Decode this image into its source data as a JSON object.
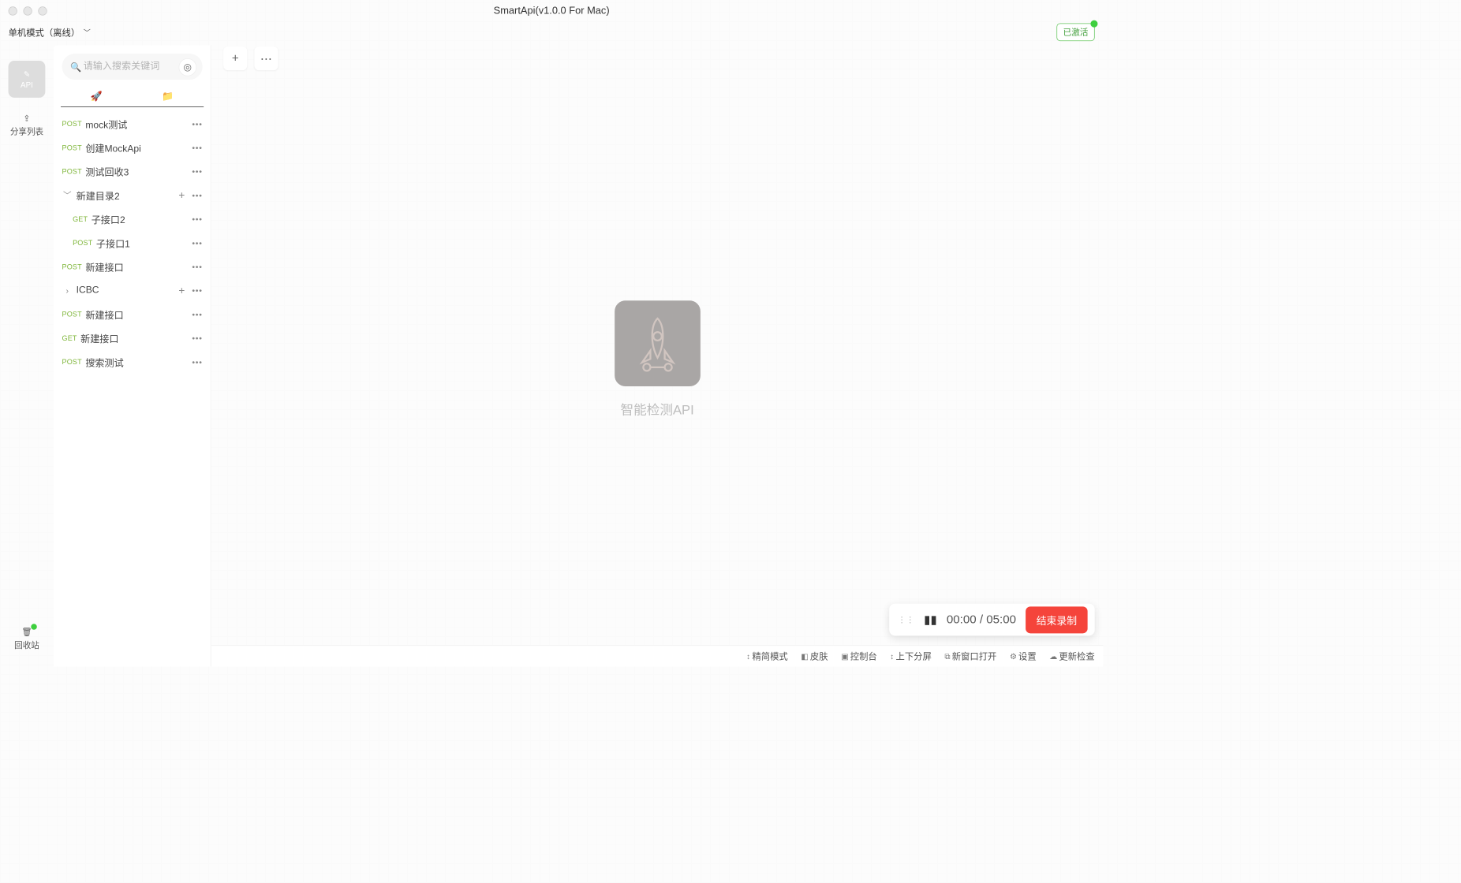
{
  "title": "SmartApi(v1.0.0 For Mac)",
  "mode": "单机模式（离线）",
  "activated": "已激活",
  "rail": {
    "api": "API",
    "share": "分享列表",
    "trash": "回收站"
  },
  "search": {
    "placeholder": "请输入搜索关键词"
  },
  "list": [
    {
      "method": "POST",
      "label": "mock测试",
      "kind": "api"
    },
    {
      "method": "POST",
      "label": "创建MockApi",
      "kind": "api"
    },
    {
      "method": "POST",
      "label": "测试回收3",
      "kind": "api"
    },
    {
      "label": "新建目录2",
      "kind": "folder",
      "expanded": true
    },
    {
      "method": "GET",
      "label": "子接口2",
      "kind": "api",
      "child": true
    },
    {
      "method": "POST",
      "label": "子接口1",
      "kind": "api",
      "child": true
    },
    {
      "method": "POST",
      "label": "新建接口",
      "kind": "api"
    },
    {
      "label": "ICBC",
      "kind": "folder",
      "expanded": false
    },
    {
      "method": "POST",
      "label": "新建接口",
      "kind": "api"
    },
    {
      "method": "GET",
      "label": "新建接口",
      "kind": "api"
    },
    {
      "method": "POST",
      "label": "搜索测试",
      "kind": "api"
    }
  ],
  "empty_caption": "智能检测API",
  "recorder": {
    "elapsed": "00:00",
    "sep": "/",
    "total": "05:00",
    "stop": "结束录制"
  },
  "status": {
    "compact": "精简模式",
    "skin": "皮肤",
    "console": "控制台",
    "split": "上下分屏",
    "newwin": "新窗口打开",
    "settings": "设置",
    "update": "更新检查"
  }
}
